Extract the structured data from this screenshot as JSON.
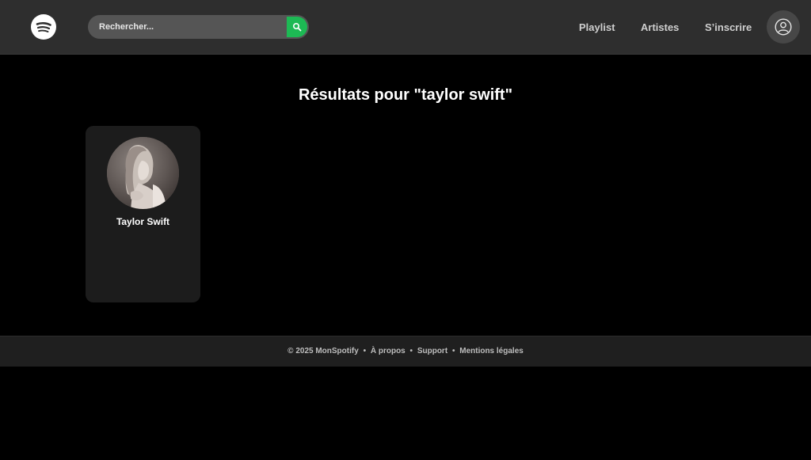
{
  "header": {
    "logo_icon": "spotify-logo-icon",
    "search": {
      "placeholder": "Rechercher...",
      "value": "",
      "button_icon": "search-icon"
    },
    "nav": {
      "playlist": "Playlist",
      "artistes": "Artistes",
      "signup": "S’inscrire"
    },
    "account_icon": "user-avatar-icon"
  },
  "main": {
    "results_title": "Résultats pour \"taylor swift\"",
    "artists": [
      {
        "name": "Taylor Swift",
        "photo": "artist-photo"
      }
    ]
  },
  "footer": {
    "copyright": "© 2025 MonSpotify",
    "separator": "•",
    "about": "À propos",
    "support": "Support",
    "legal": "Mentions légales"
  },
  "colors": {
    "header_bg": "#2e2e2e",
    "page_bg": "#000000",
    "accent": "#1db954",
    "card_bg": "#1c1c1c",
    "footer_bg": "#1f1f1f"
  }
}
